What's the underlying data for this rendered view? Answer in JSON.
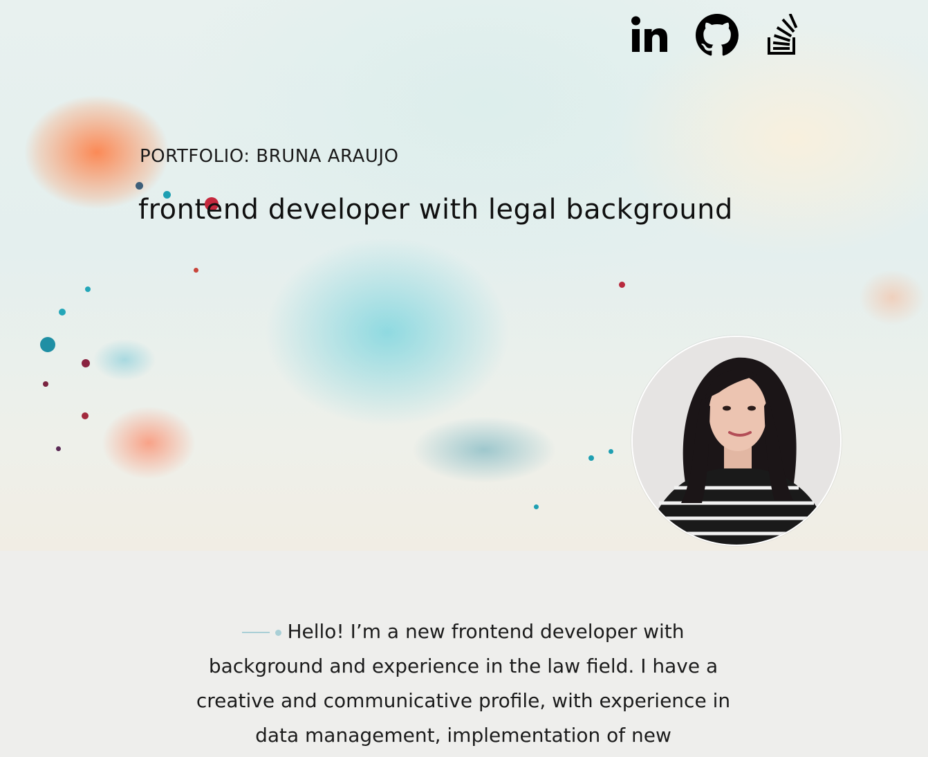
{
  "header": {
    "kicker": "PORTFOLIO: BRUNA ARAUJO",
    "headline": "frontend developer with legal background"
  },
  "social": [
    {
      "name": "linkedin-icon"
    },
    {
      "name": "github-icon"
    },
    {
      "name": "stackoverflow-icon"
    }
  ],
  "colors": {
    "background": "#eeeeec",
    "text": "#141414",
    "accent": "#a9cfd6"
  },
  "about": {
    "text": "Hello! I’m a new frontend developer with background and experience in the law field. I have a creative and communicative profile, with experience in data management, implementation of new"
  }
}
